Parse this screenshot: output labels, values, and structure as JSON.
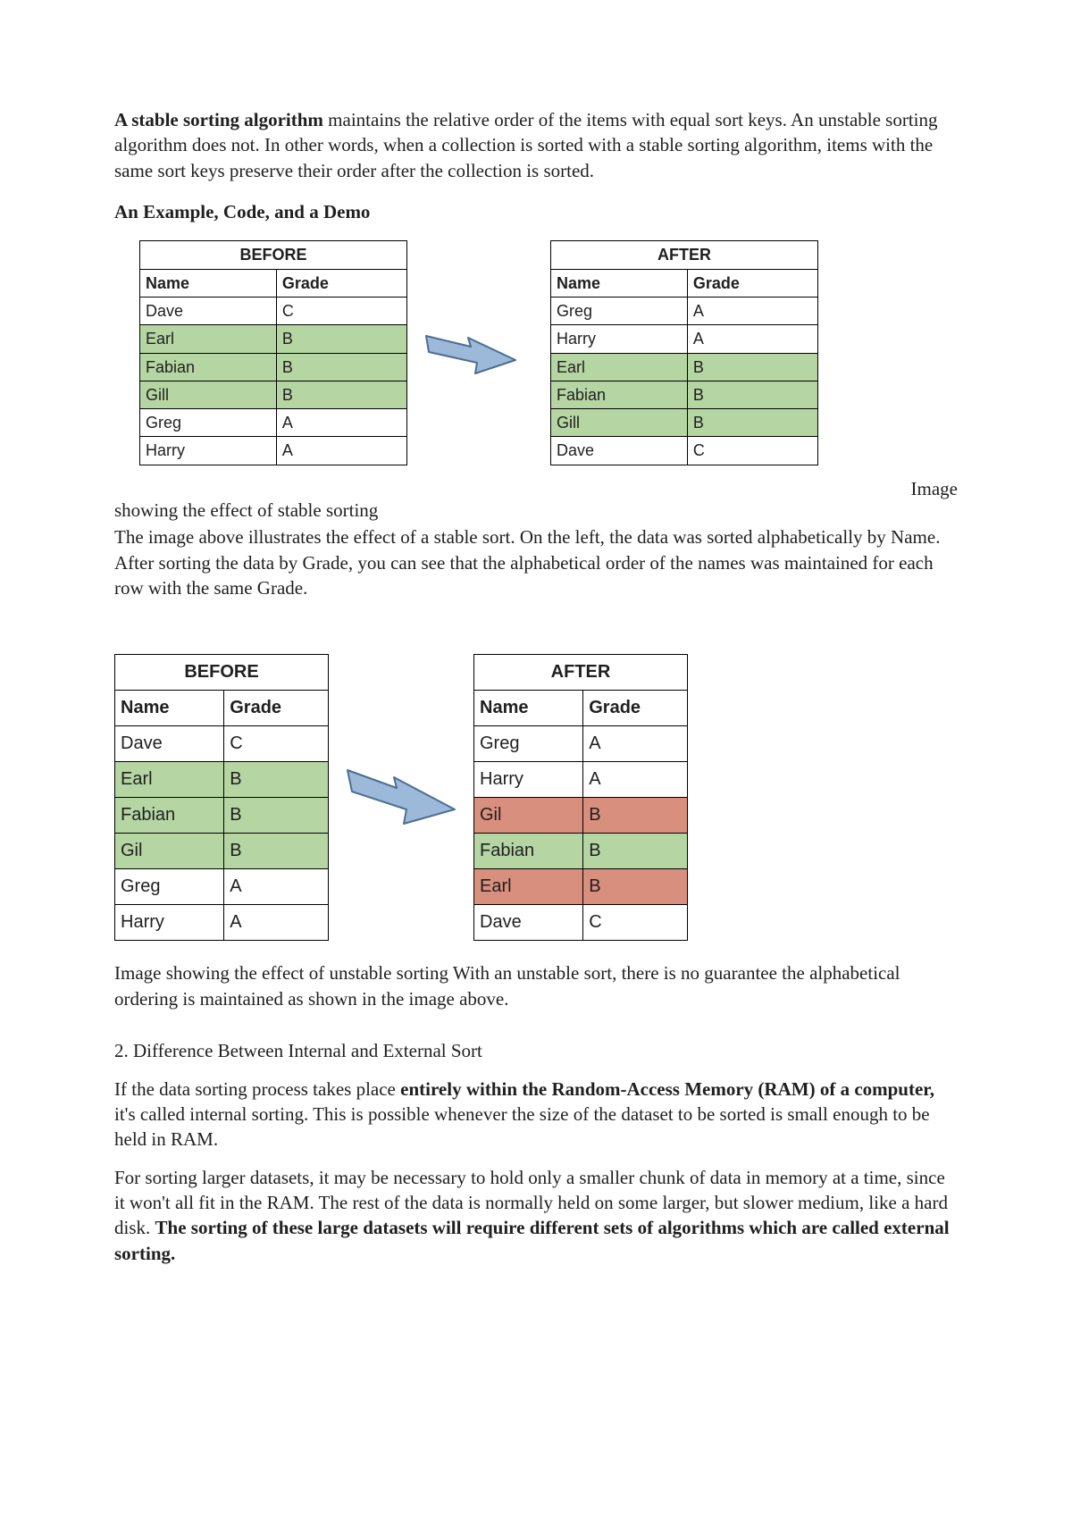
{
  "intro": {
    "strong": "A stable sorting algorithm",
    "rest": " maintains the relative order of the items with equal sort keys. An unstable sorting algorithm does not. In other words, when a collection is sorted with a stable sorting algorithm, items with the same sort keys preserve their order after the collection is sorted."
  },
  "subhead1": "An Example, Code, and a Demo",
  "colors": {
    "green": "#b5d6a3",
    "red": "#d98f7d",
    "arrowFill": "#9cb9d9",
    "arrowStroke": "#4c6e91"
  },
  "fig1": {
    "before": {
      "title": "BEFORE",
      "headers": [
        "Name",
        "Grade"
      ],
      "rows": [
        {
          "cells": [
            "Dave",
            "C"
          ],
          "hl": ""
        },
        {
          "cells": [
            "Earl",
            "B"
          ],
          "hl": "green"
        },
        {
          "cells": [
            "Fabian",
            "B"
          ],
          "hl": "green"
        },
        {
          "cells": [
            "Gill",
            "B"
          ],
          "hl": "green"
        },
        {
          "cells": [
            "Greg",
            "A"
          ],
          "hl": ""
        },
        {
          "cells": [
            "Harry",
            "A"
          ],
          "hl": ""
        }
      ]
    },
    "after": {
      "title": "AFTER",
      "headers": [
        "Name",
        "Grade"
      ],
      "rows": [
        {
          "cells": [
            "Greg",
            "A"
          ],
          "hl": ""
        },
        {
          "cells": [
            "Harry",
            "A"
          ],
          "hl": ""
        },
        {
          "cells": [
            "Earl",
            "B"
          ],
          "hl": "green"
        },
        {
          "cells": [
            "Fabian",
            "B"
          ],
          "hl": "green"
        },
        {
          "cells": [
            "Gill",
            "B"
          ],
          "hl": "green"
        },
        {
          "cells": [
            "Dave",
            "C"
          ],
          "hl": ""
        }
      ]
    }
  },
  "fig1_label_right": "Image",
  "fig1_label_cont": "showing the effect of stable sorting",
  "fig1_explain": "The image above illustrates the effect of a stable sort. On the left, the data was sorted alphabetically by Name. After sorting the data by Grade, you can see that the alphabetical order of the names was maintained for each row with the same Grade.",
  "fig2": {
    "before": {
      "title": "BEFORE",
      "headers": [
        "Name",
        "Grade"
      ],
      "rows": [
        {
          "cells": [
            "Dave",
            "C"
          ],
          "hl": ""
        },
        {
          "cells": [
            "Earl",
            "B"
          ],
          "hl": "green"
        },
        {
          "cells": [
            "Fabian",
            "B"
          ],
          "hl": "green"
        },
        {
          "cells": [
            "Gil",
            "B"
          ],
          "hl": "green"
        },
        {
          "cells": [
            "Greg",
            "A"
          ],
          "hl": ""
        },
        {
          "cells": [
            "Harry",
            "A"
          ],
          "hl": ""
        }
      ]
    },
    "after": {
      "title": "AFTER",
      "headers": [
        "Name",
        "Grade"
      ],
      "rows": [
        {
          "cells": [
            "Greg",
            "A"
          ],
          "hl": ""
        },
        {
          "cells": [
            "Harry",
            "A"
          ],
          "hl": ""
        },
        {
          "cells": [
            "Gil",
            "B"
          ],
          "hl": "red"
        },
        {
          "cells": [
            "Fabian",
            "B"
          ],
          "hl": "green"
        },
        {
          "cells": [
            "Earl",
            "B"
          ],
          "hl": "red"
        },
        {
          "cells": [
            "Dave",
            "C"
          ],
          "hl": ""
        }
      ]
    }
  },
  "fig2_caption": "Image showing the effect of unstable sorting With an unstable sort, there is no guarantee the alphabetical ordering is maintained as shown in the image above.",
  "section2_heading": "2. Difference Between Internal and External Sort",
  "section2_p1_a": "If the data sorting process takes place ",
  "section2_p1_b": "entirely within the Random-Access Memory (RAM) of a computer,",
  "section2_p1_c": " it's called internal sorting. This is possible whenever the size of the dataset to be sorted is small enough to be held in RAM.",
  "section2_p2_a": "For sorting larger datasets, it may be necessary to hold only a smaller chunk of data in memory at a time, since it won't all fit in the RAM. The rest of the data is normally held on some larger, but slower medium, like a hard disk. ",
  "section2_p2_b": "The sorting of these large datasets will require different sets of algorithms which are called external sorting."
}
